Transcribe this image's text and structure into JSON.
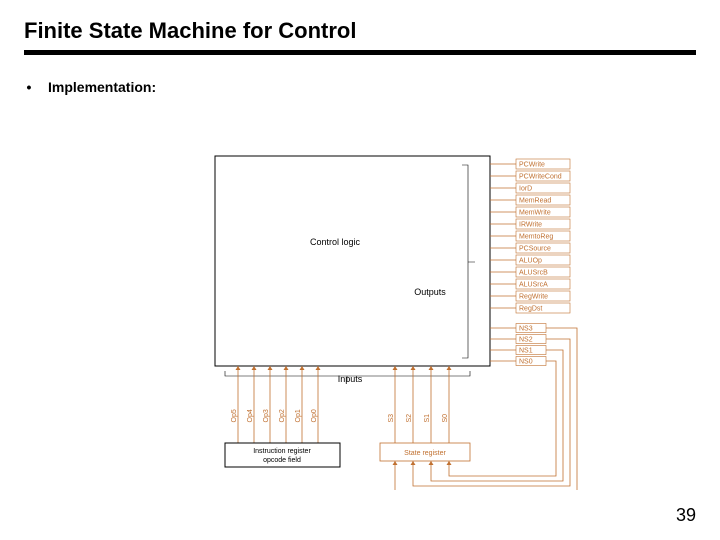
{
  "title": "Finite State Machine for Control",
  "bullet": {
    "label": "Implementation:"
  },
  "page": "39",
  "diagram": {
    "main_block": "Control logic",
    "outputs_label": "Outputs",
    "inputs_label": "Inputs",
    "output_signals": [
      "PCWrite",
      "PCWriteCond",
      "IorD",
      "MemRead",
      "MemWrite",
      "IRWrite",
      "MemtoReg",
      "PCSource",
      "ALUOp",
      "ALUSrcB",
      "ALUSrcA",
      "RegWrite",
      "RegDst"
    ],
    "next_state_signals": [
      "NS3",
      "NS2",
      "NS1",
      "NS0"
    ],
    "opcode_inputs": [
      "Op5",
      "Op4",
      "Op3",
      "Op2",
      "Op1",
      "Op0"
    ],
    "state_inputs": [
      "S3",
      "S2",
      "S1",
      "S0"
    ],
    "opcode_block": "Instruction register opcode field",
    "state_block": "State register"
  }
}
